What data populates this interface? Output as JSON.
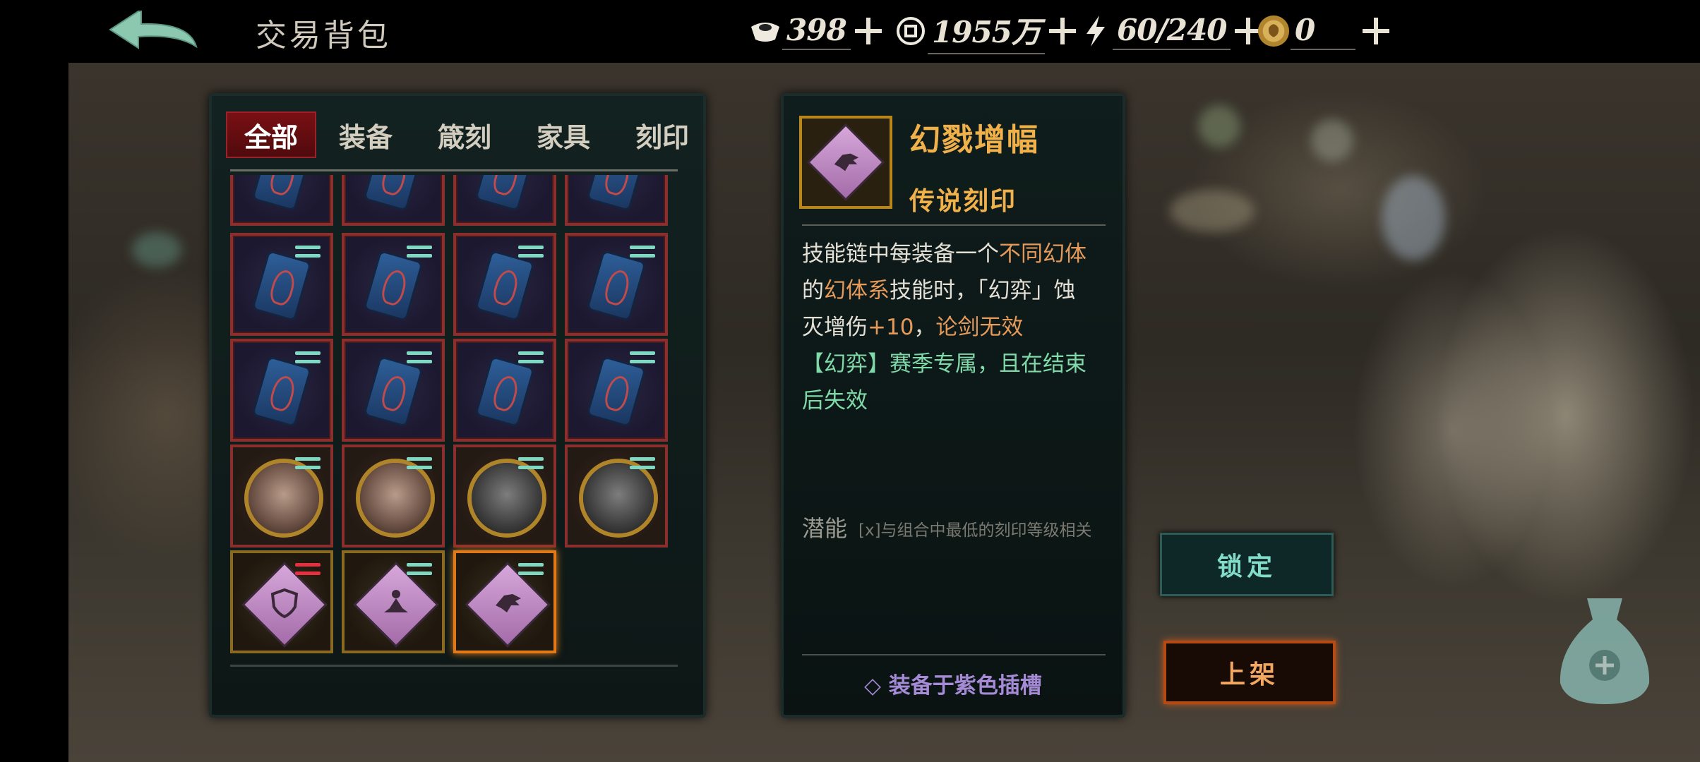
{
  "header": {
    "title": "交易背包",
    "resources": [
      {
        "icon": "ingot-icon",
        "value": "398"
      },
      {
        "icon": "coin-icon",
        "value": "1955万"
      },
      {
        "icon": "energy-icon",
        "value": "60/240"
      },
      {
        "icon": "token-icon",
        "value": "0"
      }
    ]
  },
  "tabs": [
    {
      "label": "全部",
      "active": true
    },
    {
      "label": "装备",
      "active": false
    },
    {
      "label": "箴刻",
      "active": false
    },
    {
      "label": "家具",
      "active": false
    },
    {
      "label": "刻印",
      "active": false
    }
  ],
  "detail": {
    "name": "幻戮增幅",
    "rarity": "传说刻印",
    "desc_line1_a": "技能链中每装备一个",
    "desc_line1_hl": "不同幻体",
    "desc_line2_a": "的",
    "desc_line2_hl": "幻体系",
    "desc_line2_b": "技能时，「幻弈」蚀",
    "desc_line3_a": "灭增伤",
    "desc_line3_hl": "+10",
    "desc_line3_b": "，",
    "desc_line3_hl2": "论剑无效",
    "desc_line4": "【幻弈】赛季专属，且在结束",
    "desc_line5": "后失效",
    "potential_label": "潜能",
    "potential_text": "[x]与组合中最低的刻印等级相关",
    "slot_hint": "◇ 装备于紫色插槽"
  },
  "buttons": {
    "lock": "锁定",
    "sell": "上架"
  },
  "colors": {
    "accent_gold": "#f0b04a",
    "accent_teal": "#82dcc7",
    "accent_orange": "#f3a862",
    "purple_hint": "#a58ad6",
    "tab_active": "#7a1014"
  }
}
